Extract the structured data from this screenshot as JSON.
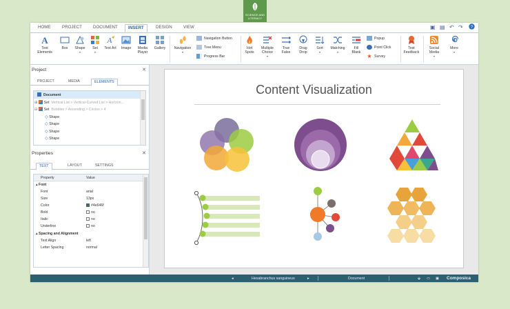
{
  "brand": {
    "logo_text": "SCIENCE AND LITERACY"
  },
  "menu": {
    "tabs": [
      "HOME",
      "PROJECT",
      "DOCUMENT",
      "INSERT",
      "DESIGN",
      "VIEW"
    ],
    "active": "INSERT"
  },
  "ribbon": {
    "text_elements": "Text Elements",
    "box": "Box",
    "shape": "Shape",
    "set": "Set",
    "text_art": "Text Art",
    "image": "Image",
    "media_player": "Media Player",
    "gallery": "Gallery",
    "navigation": "Navigation",
    "navigation_button": "Navigation Button",
    "tree_menu": "Tree Menu",
    "progress_bar": "Progress Bar",
    "hot_spots": "Hot Spots",
    "multiple_choice": "Multiple Choice",
    "true_false": "True False",
    "drag_drop": "Drag Drop",
    "sort": "Sort",
    "matching": "Matching",
    "fill_blank": "Fill Blank",
    "popup": "Popup",
    "point_click": "Point Click",
    "survey": "Survey",
    "test_feedback": "Test Feedback",
    "social_media": "Social Media",
    "more": "More"
  },
  "project_panel": {
    "title": "Project",
    "tabs": [
      "PROJECT",
      "MEDIA",
      "ELEMENTS"
    ],
    "active_tab": "ELEMENTS",
    "tree": [
      {
        "label": "Document",
        "path": ""
      },
      {
        "label": "Set",
        "path": "Vertical List > Vertical-Curved List > Horizon..."
      },
      {
        "label": "Set",
        "path": "Bubbles > Ascending > Circles > 4"
      },
      {
        "label": "Shape",
        "path": ""
      },
      {
        "label": "Shape",
        "path": ""
      },
      {
        "label": "Shape",
        "path": ""
      },
      {
        "label": "Shape",
        "path": ""
      }
    ]
  },
  "properties_panel": {
    "title": "Properties",
    "tabs": [
      "TEXT",
      "LAYOUT",
      "SETTINGS"
    ],
    "active_tab": "TEXT",
    "header": {
      "property": "Property",
      "value": "Value"
    },
    "groups": [
      {
        "name": "Font",
        "rows": [
          {
            "k": "Font",
            "v": "arial"
          },
          {
            "k": "Size",
            "v": "13px"
          },
          {
            "k": "Color",
            "v": "#4e646f"
          },
          {
            "k": "Bold",
            "v": "no"
          },
          {
            "k": "Italic",
            "v": "no"
          },
          {
            "k": "Underline",
            "v": "no"
          }
        ]
      },
      {
        "name": "Spacing and Alignment",
        "rows": [
          {
            "k": "Text Align",
            "v": "left"
          },
          {
            "k": "Letter Spacing",
            "v": "normal"
          }
        ]
      }
    ]
  },
  "slide": {
    "title": "Content Visualization"
  },
  "status_bar": {
    "element": "Hexabranchus sanguineus",
    "view": "Document",
    "brand": "Composica"
  },
  "colors": {
    "status_bar": "#2c5f6f",
    "accent": "#2a5ea8",
    "purple": "#7d4d8e",
    "orange": "#f0a23a",
    "green": "#8fbf3f",
    "honeycomb": "#f2c77a"
  }
}
